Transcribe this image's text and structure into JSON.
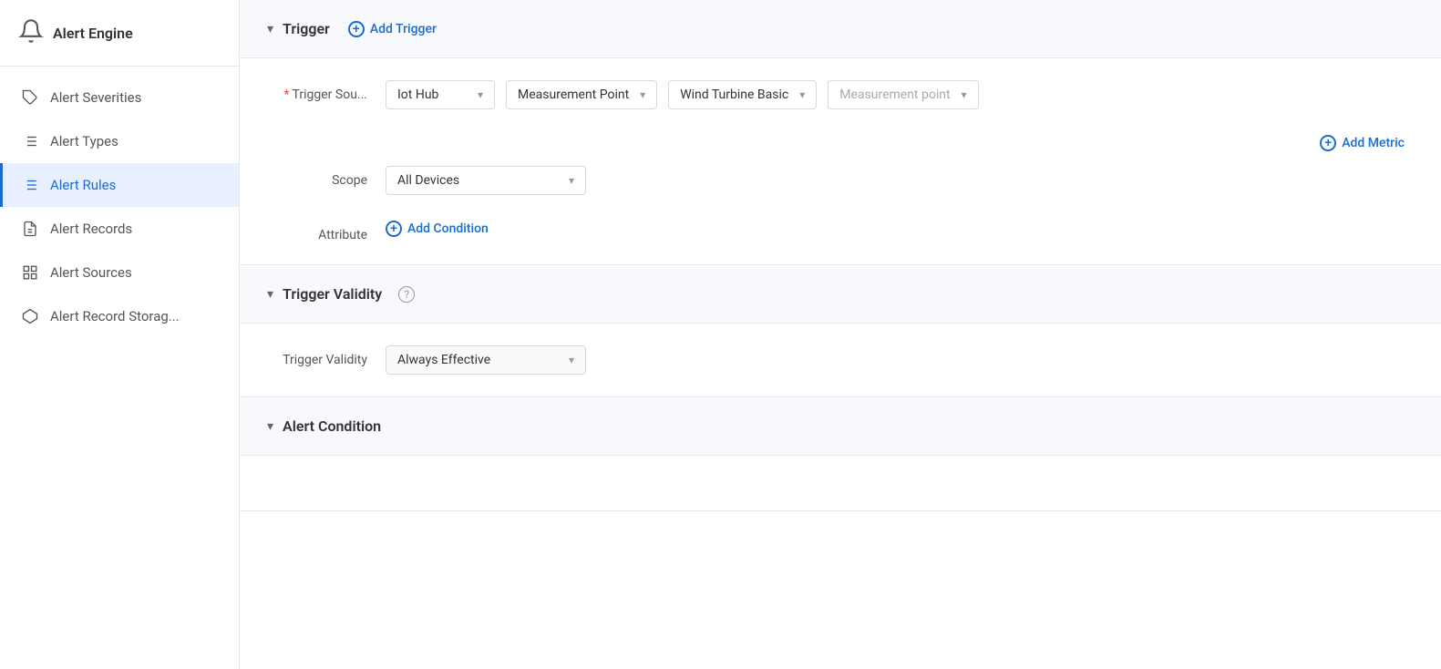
{
  "sidebar": {
    "app_name": "Alert Engine",
    "items": [
      {
        "id": "severities",
        "label": "Alert Severities",
        "icon": "tag",
        "active": false
      },
      {
        "id": "types",
        "label": "Alert Types",
        "icon": "list",
        "active": false
      },
      {
        "id": "rules",
        "label": "Alert Rules",
        "icon": "rules",
        "active": true
      },
      {
        "id": "records",
        "label": "Alert Records",
        "icon": "doc",
        "active": false
      },
      {
        "id": "sources",
        "label": "Alert Sources",
        "icon": "grid",
        "active": false
      },
      {
        "id": "storage",
        "label": "Alert Record Storag...",
        "icon": "hexagon",
        "active": false
      }
    ]
  },
  "trigger_section": {
    "title": "Trigger",
    "add_trigger_label": "Add Trigger",
    "trigger_source_label": "Trigger Sou...",
    "trigger_source_required": true,
    "dropdowns": {
      "source": {
        "value": "Iot Hub",
        "placeholder": ""
      },
      "type": {
        "value": "Measurement Point",
        "placeholder": ""
      },
      "model": {
        "value": "Wind Turbine Basic",
        "placeholder": ""
      },
      "metric": {
        "value": "",
        "placeholder": "Measurement point"
      }
    },
    "add_metric_label": "Add Metric",
    "scope_label": "Scope",
    "scope_value": "All Devices",
    "attribute_label": "Attribute",
    "add_condition_label": "Add Condition"
  },
  "validity_section": {
    "title": "Trigger Validity",
    "validity_label": "Trigger Validity",
    "validity_value": "Always Effective"
  },
  "alert_condition_section": {
    "title": "Alert Condition"
  }
}
